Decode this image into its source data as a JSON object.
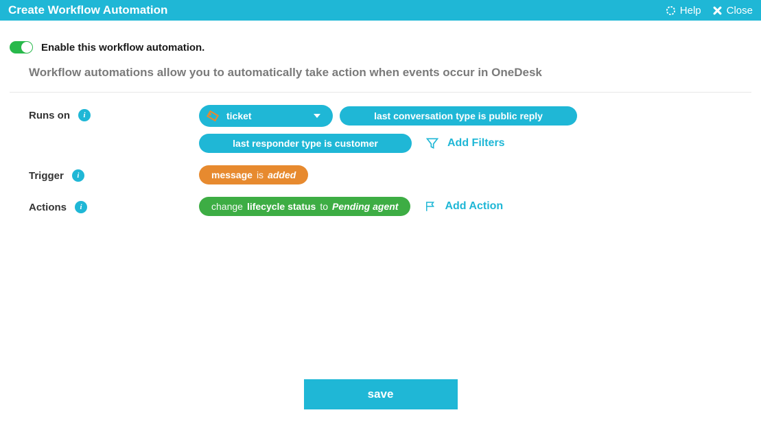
{
  "header": {
    "title": "Create Workflow Automation",
    "help": "Help",
    "close": "Close"
  },
  "enable": {
    "label": "Enable this workflow automation."
  },
  "description": "Workflow automations allow you to automatically take action when events occur in OneDesk",
  "sections": {
    "runs_on": {
      "label": "Runs on",
      "type": "ticket",
      "filter1": "last conversation type is public reply",
      "filter2": "last responder type is customer",
      "add_filters": "Add Filters"
    },
    "trigger": {
      "label": "Trigger",
      "field": "message",
      "op": "is",
      "value": "added"
    },
    "actions": {
      "label": "Actions",
      "verb": "change",
      "field": "lifecycle status",
      "op": "to",
      "value": "Pending agent",
      "add_action": "Add Action"
    }
  },
  "buttons": {
    "save": "save"
  },
  "colors": {
    "primary": "#1fb7d6",
    "orange": "#e78a2f",
    "green": "#3dad44"
  }
}
